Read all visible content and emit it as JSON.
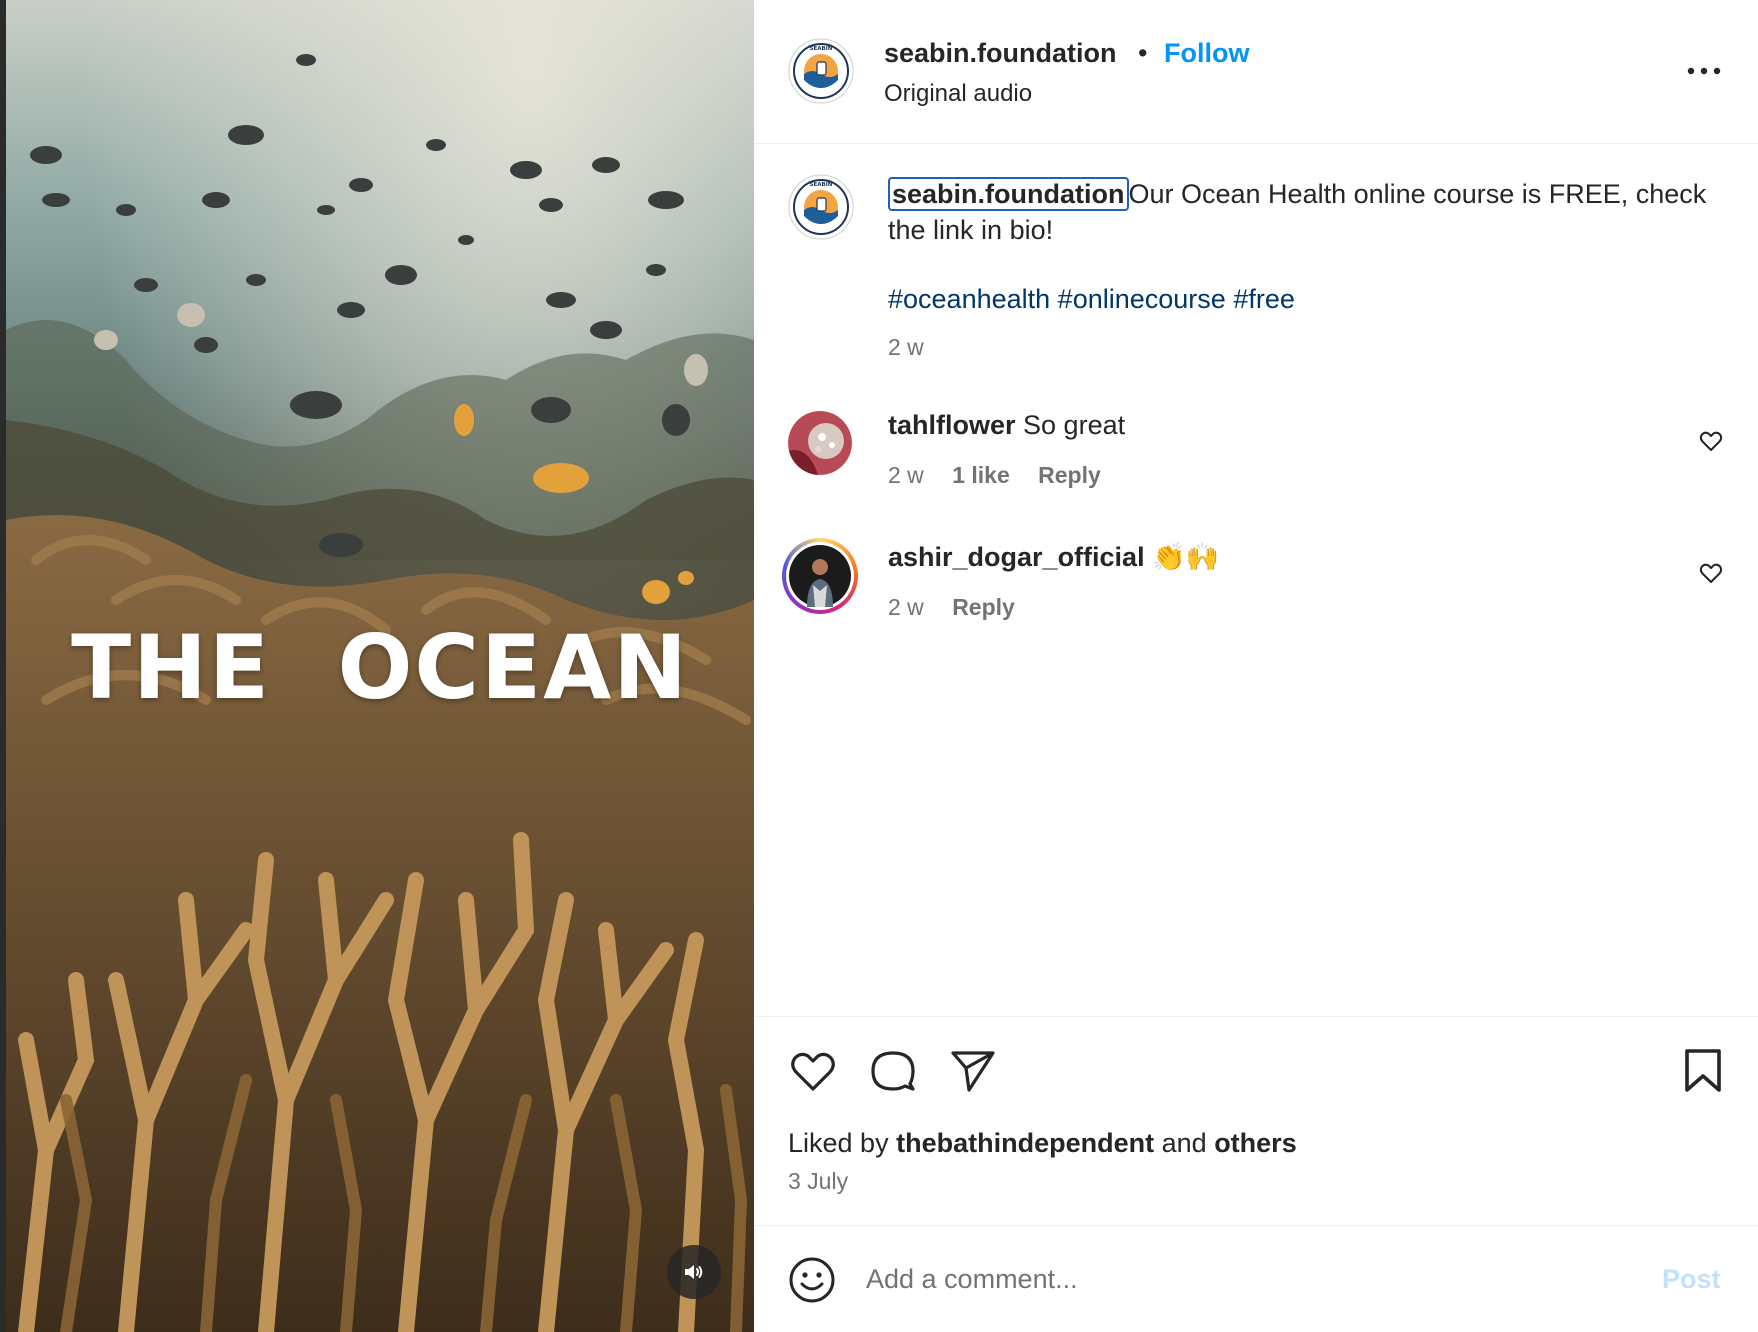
{
  "media": {
    "overlay_text": "THE  OCEAN",
    "mute_icon": "volume-icon"
  },
  "header": {
    "username": "seabin.foundation",
    "separator": "•",
    "follow_label": "Follow",
    "audio": "Original audio",
    "more_icon": "more-horizontal-icon"
  },
  "caption": {
    "username": "seabin.foundation",
    "text": "Our Ocean Health online course is FREE, check the link in bio!",
    "hashtags": [
      "#oceanhealth",
      "#onlinecourse",
      "#free"
    ],
    "time": "2 w"
  },
  "comments": [
    {
      "username": "tahlflower",
      "text": "So great",
      "time": "2 w",
      "likes": "1 like",
      "reply_label": "Reply"
    },
    {
      "username": "ashir_dogar_official",
      "text": "👏🙌",
      "time": "2 w",
      "reply_label": "Reply"
    }
  ],
  "actions": {
    "liked_prefix": "Liked by",
    "liked_user": "thebathindependent",
    "liked_and": "and",
    "liked_others": "others",
    "date": "3 July"
  },
  "comment_bar": {
    "placeholder": "Add a comment...",
    "post_label": "Post"
  },
  "colors": {
    "accent": "#0095f6",
    "hashtag": "#00376b",
    "muted": "#737373",
    "post_disabled": "#c3e1fc"
  }
}
